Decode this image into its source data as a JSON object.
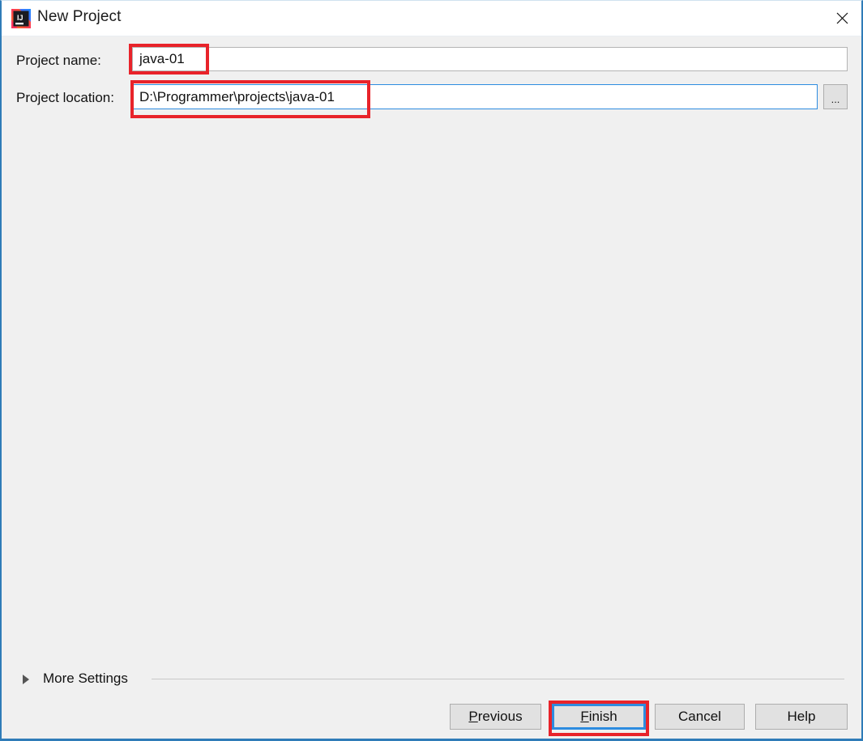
{
  "window": {
    "title": "New Project",
    "icon": "intellij-idea-icon",
    "close_label": "✕",
    "border_color": "#2f7cb8"
  },
  "form": {
    "name_label": "Project name:",
    "name_value": "java-01",
    "location_label": "Project location:",
    "location_value": "D:\\Programmer\\projects\\java-01",
    "browse_label": "...",
    "focus_border_color": "#2d8ce0",
    "idle_border_color": "#b4b4b4"
  },
  "more_settings": {
    "label": "More Settings",
    "expander_icon": "triangle-right-icon",
    "expanded": false
  },
  "buttons": {
    "previous": {
      "label": "Previous",
      "mnemonic": "P"
    },
    "finish": {
      "label": "Finish",
      "mnemonic": "F",
      "focused": true
    },
    "cancel": {
      "label": "Cancel",
      "mnemonic": ""
    },
    "help": {
      "label": "Help",
      "mnemonic": ""
    }
  },
  "annotations": {
    "color": "#e8232a",
    "targets": [
      "project-name-value",
      "project-location-value",
      "finish-button"
    ]
  }
}
